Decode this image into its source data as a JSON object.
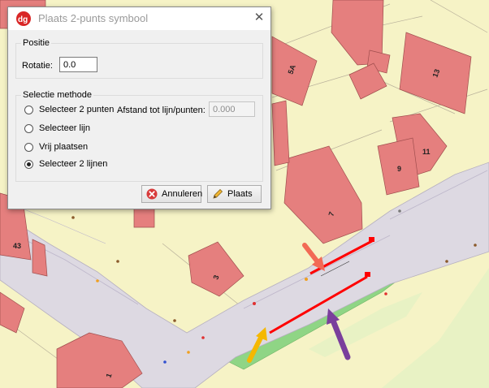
{
  "dialog": {
    "title": "Plaats 2-punts symbool",
    "close_glyph": "✕",
    "logo_icon": "dg-logo-icon",
    "positie": {
      "group_title": "Positie",
      "rotatie_label": "Rotatie:",
      "rotatie_value": "0.0"
    },
    "selectie": {
      "group_title": "Selectie methode",
      "options": [
        {
          "label": "Selecteer 2 punten",
          "checked": false
        },
        {
          "label": "Selecteer lijn",
          "checked": false
        },
        {
          "label": "Vrij plaatsen",
          "checked": false
        },
        {
          "label": "Selecteer 2 lijnen",
          "checked": true
        }
      ],
      "afstand_label": "Afstand tot lijn/punten:",
      "afstand_value": "0.000"
    },
    "buttons": {
      "cancel_label": "Annuleren",
      "cancel_icon": "cancel-x-icon",
      "place_label": "Plaats",
      "place_icon": "pencil-icon"
    }
  },
  "map": {
    "house_numbers": [
      "5A",
      "13",
      "9",
      "11",
      "7",
      "3",
      "1",
      "43"
    ],
    "colors": {
      "land": "#f6f3c6",
      "building": "#e57f7e",
      "road": "#ddd9e2",
      "green": "#8fd585",
      "selected_line": "#ff0000",
      "arrow_red": "#f26a55",
      "arrow_yellow": "#f5b800",
      "arrow_purple": "#7a3f9c"
    }
  }
}
